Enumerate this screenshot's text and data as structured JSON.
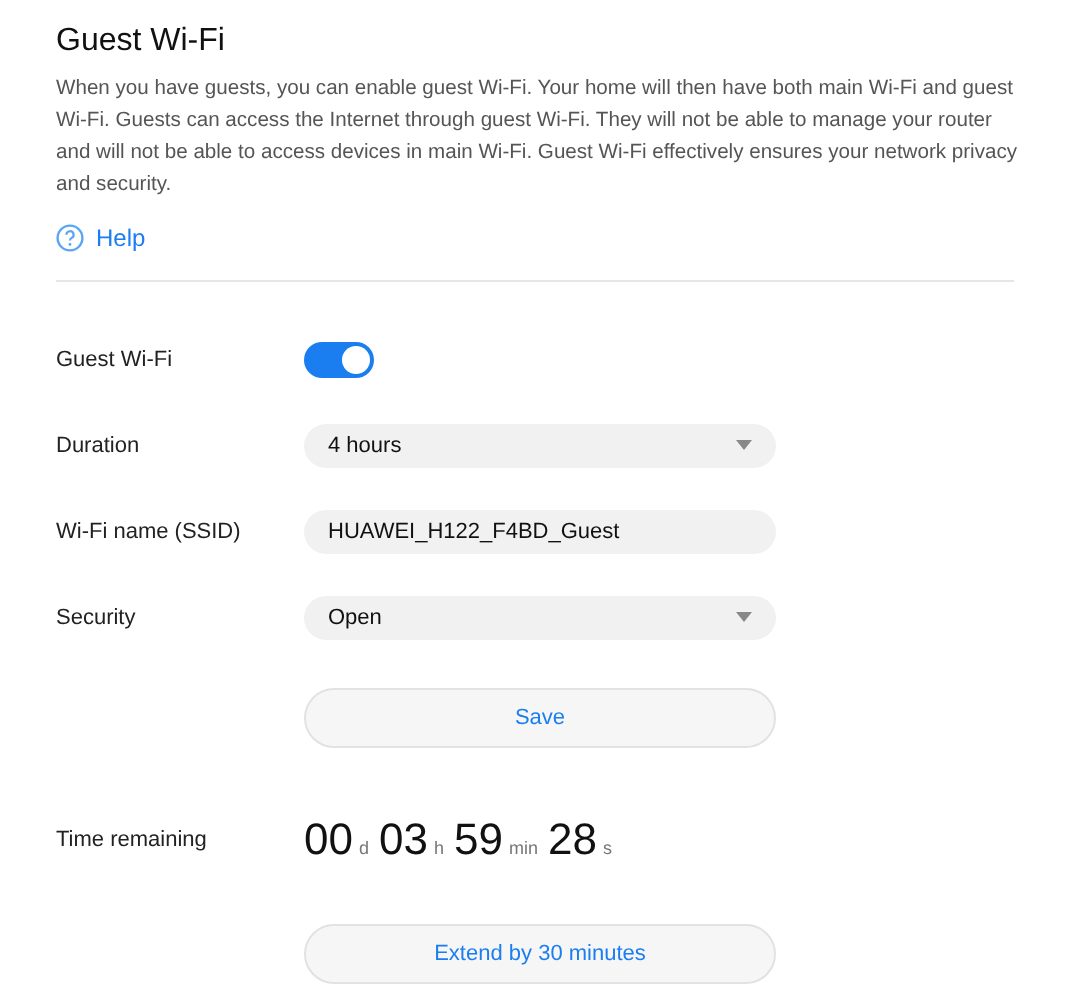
{
  "title": "Guest Wi-Fi",
  "description": "When you have guests, you can enable guest Wi-Fi. Your home will then have both main Wi-Fi and guest Wi-Fi. Guests can access the Internet through guest Wi-Fi. They will not be able to manage your router and will not be able to access devices in main Wi-Fi. Guest Wi-Fi effectively ensures your network privacy and security.",
  "help_link": "Help",
  "settings": [
    {
      "kind": "toggle",
      "label": "Guest Wi-Fi",
      "on": true
    },
    {
      "kind": "select",
      "label": "Duration",
      "value": "4 hours"
    },
    {
      "kind": "text",
      "label": "Wi-Fi name (SSID)",
      "value": "HUAWEI_H122_F4BD_Guest"
    },
    {
      "kind": "select",
      "label": "Security",
      "value": "Open"
    }
  ],
  "save_button": "Save",
  "time_remaining": {
    "label": "Time remaining",
    "parts": [
      {
        "value": "00",
        "unit": "d"
      },
      {
        "value": "03",
        "unit": "h"
      },
      {
        "value": "59",
        "unit": "min"
      },
      {
        "value": "28",
        "unit": "s"
      }
    ]
  },
  "extend_button": "Extend by 30 minutes"
}
